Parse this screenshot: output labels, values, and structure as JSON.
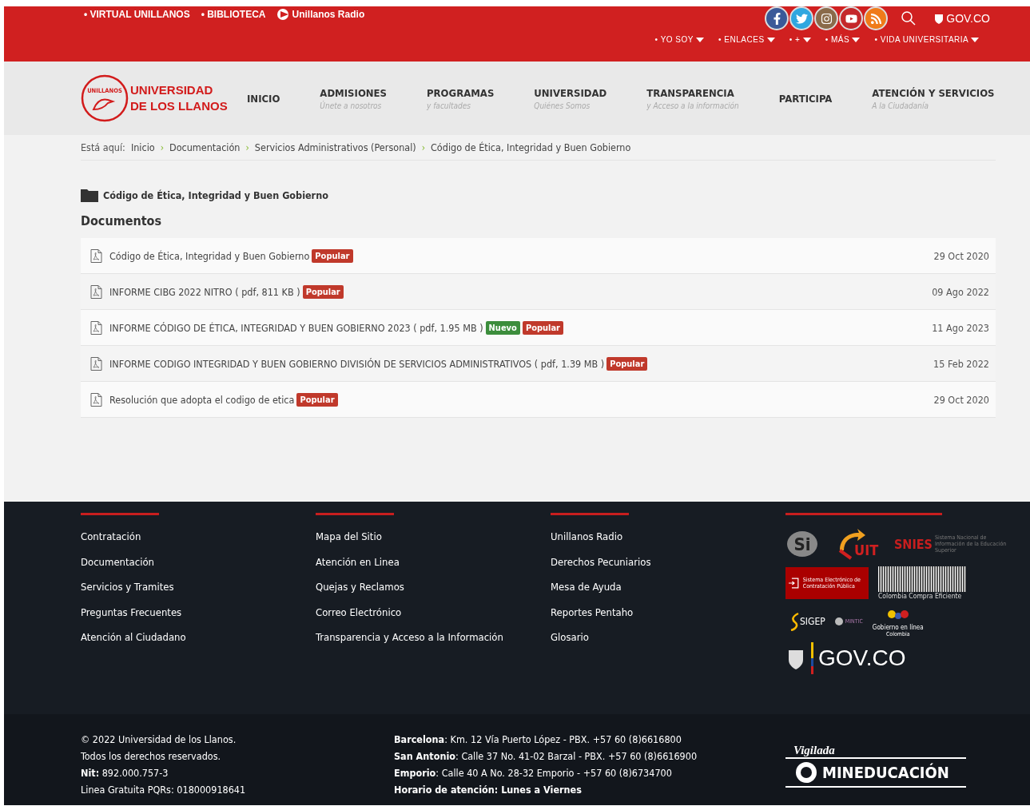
{
  "topbar": {
    "links": [
      "• VIRTUAL UNILLANOS",
      "• BIBLIOTECA"
    ],
    "radio": "Unillanos Radio",
    "social": [
      {
        "kind": "facebook",
        "color": "#3b5998"
      },
      {
        "kind": "twitter",
        "color": "#2fa7e0"
      },
      {
        "kind": "instagram",
        "color": "#8a6a4a"
      },
      {
        "kind": "youtube",
        "color": "#c4282b"
      },
      {
        "kind": "rss",
        "color": "#f07b1a"
      }
    ],
    "govco": "GOV.CO",
    "menu": [
      "• YO SOY",
      "• ENLACES",
      "• +",
      "• MÁS",
      "• VIDA UNIVERSITARIA"
    ]
  },
  "logo": {
    "ring": "UNILLANOS",
    "line1": "UNIVERSIDAD",
    "line2": "DE LOS LLANOS"
  },
  "nav": [
    {
      "label": "INICIO"
    },
    {
      "label": "ADMISIONES",
      "sub": "Únete a nosotros"
    },
    {
      "label": "PROGRAMAS",
      "sub": "y facultades"
    },
    {
      "label": "UNIVERSIDAD",
      "sub": "Quiénes Somos"
    },
    {
      "label": "TRANSPARENCIA",
      "sub": "y Acceso a la información"
    },
    {
      "label": "PARTICIPA"
    },
    {
      "label": "ATENCIÓN Y SERVICIOS",
      "sub": "A la Ciudadanía"
    }
  ],
  "breadcrumb": {
    "prefix": "Está aquí:",
    "separator": "›",
    "items": [
      "Inicio",
      "Documentación",
      "Servicios Administrativos (Personal)",
      "Código de Ética, Integridad y Buen Gobierno"
    ]
  },
  "category": "Código de Ética, Integridad y Buen Gobierno",
  "section_title": "Documentos",
  "documents": [
    {
      "title": "Código de Ética, Integridad y Buen Gobierno",
      "badges": [
        {
          "kind": "popular",
          "text": "Popular"
        }
      ],
      "date": "29 Oct 2020"
    },
    {
      "title": "INFORME CIBG 2022 NITRO ( pdf, 811 KB )",
      "badges": [
        {
          "kind": "popular",
          "text": "Popular"
        }
      ],
      "date": "09 Ago 2022"
    },
    {
      "title": "INFORME CÓDIGO DE ÉTICA, INTEGRIDAD Y BUEN GOBIERNO 2023 ( pdf, 1.95 MB )",
      "badges": [
        {
          "kind": "new",
          "text": "Nuevo"
        },
        {
          "kind": "popular",
          "text": "Popular"
        }
      ],
      "date": "11 Ago 2023"
    },
    {
      "title": "INFORME CODIGO INTEGRIDAD Y BUEN GOBIERNO DIVISIÓN DE SERVICIOS ADMINISTRATIVOS ( pdf, 1.39 MB )",
      "badges": [
        {
          "kind": "popular",
          "text": "Popular"
        }
      ],
      "date": "15 Feb 2022"
    },
    {
      "title": "Resolución que adopta el codigo de etica",
      "badges": [
        {
          "kind": "popular",
          "text": "Popular"
        }
      ],
      "date": "29 Oct 2020"
    }
  ],
  "footer": {
    "columns": [
      [
        "Contratación",
        "Documentación",
        "Servicios y Tramites",
        "Preguntas Frecuentes",
        "Atención al Ciudadano"
      ],
      [
        "Mapa del Sitio",
        "Atención en Linea",
        "Quejas y Reclamos",
        "Correo Electrónico",
        "Transparencia y Acceso a la Información"
      ],
      [
        "Unillanos Radio",
        "Derechos Pecuniarios",
        "Mesa de Ayuda",
        "Reportes Pentaho",
        "Glosario"
      ]
    ],
    "logos": {
      "si": "Si",
      "suit": "UIT",
      "snies": "SNIES",
      "snies_sub": "Sistema Nacional de Información de la Educación Superior",
      "secop": "Sistema Electrónico de Contratación Pública",
      "cce": "Colombia Compra Eficiente",
      "sigep": "SIGEP",
      "mintic": "MINTIC",
      "gel": "Gobierno en línea",
      "gel_sub": "Colombia",
      "govco": "GOV.CO"
    }
  },
  "bottom": {
    "left": [
      "© 2022 Universidad de los Llanos.",
      "Todos los derechos reservados.",
      "**Nit:** 892.000.757-3",
      "Linea Gratuita PQRs: 018000918641"
    ],
    "right": [
      "**Barcelona**: Km. 12 Vía Puerto López - PBX. +57 60 (8)6616800",
      "**San Antonio**: Calle 37 No. 41-02 Barzal - PBX. +57 60 (8)6616900",
      "**Emporio**: Calle 40 A No. 28-32 Emporio - +57 60 (8)6734700",
      "**Horario de atención: Lunes a Viernes**"
    ],
    "vigilada": "Vigilada",
    "mineducacion": "MINEDUCACIÓN"
  }
}
